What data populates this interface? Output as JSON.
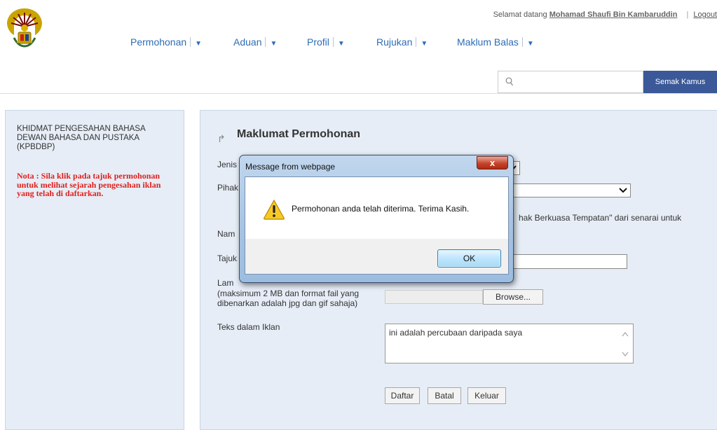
{
  "header": {
    "welcome_prefix": "Selamat datang",
    "user_name": "Mohamad Shaufi Bin Kambaruddin",
    "separator": "|",
    "logout": "Logout",
    "nav": [
      {
        "label": "Permohonan"
      },
      {
        "label": "Aduan"
      },
      {
        "label": "Profil"
      },
      {
        "label": "Rujukan"
      },
      {
        "label": "Maklum Balas"
      }
    ],
    "search": {
      "placeholder": "",
      "button": "Semak Kamus"
    }
  },
  "sidebar": {
    "title": "KHIDMAT PENGESAHAN BAHASA DEWAN BAHASA DAN PUSTAKA (KPBDBP)",
    "note": "Nota : Sila klik pada tajuk permohonan untuk melihat sejarah pengesahan iklan yang telah di daftarkan."
  },
  "form": {
    "title": "Maklumat Permohonan",
    "jenis_label": "Jenis",
    "pihak_label": "Pihak",
    "help_text": "hak Berkuasa Tempatan\" dari senarai untuk",
    "nama_label": "Nam",
    "tajuk_label": "Tajuk",
    "lampiran_label": "Lam",
    "lampiran_note1": "(maksimum 2 MB dan format fail yang",
    "lampiran_note2": "dibenarkan adalah jpg dan gif  sahaja)",
    "browse": "Browse...",
    "teks_label": "Teks dalam Iklan",
    "teks_value": "ini adalah percubaan daripada saya",
    "buttons": {
      "daftar": "Daftar",
      "batal": "Batal",
      "keluar": "Keluar"
    }
  },
  "dialog": {
    "title": "Message from webpage",
    "close": "x",
    "message": "Permohonan anda telah diterima. Terima Kasih.",
    "ok": "OK"
  },
  "colors": {
    "accent": "#3b5998",
    "nav_link": "#2c6db6",
    "note_red": "#e0201c",
    "panel_bg": "#e6edf6"
  }
}
